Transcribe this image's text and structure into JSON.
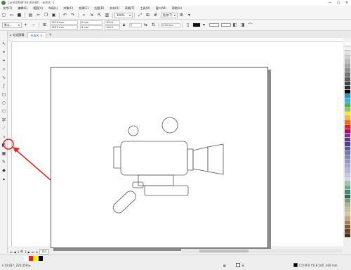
{
  "window": {
    "title": "CorelDRAW X8 (64-Bit) - 未命名 -1",
    "controls": [
      "—",
      "□",
      "✕"
    ]
  },
  "menu": [
    "文件(F)",
    "编辑(E)",
    "视图(V)",
    "布局(L)",
    "对象(C)",
    "效果(C)",
    "位图(B)",
    "文本(X)",
    "表格(T)",
    "工具(O)",
    "窗口(W)",
    "帮助(H)"
  ],
  "standard_toolbar": {
    "zoom_value": "100%",
    "snap_label": "贴齐(T)"
  },
  "property_bar": {
    "preset": "默认...",
    "x": "193.6 mm",
    "y": "148.3 mm",
    "w": "0 mm",
    "h": "0 mm",
    "scale_w": "100.0",
    "scale_h": "100.0",
    "rotation": "0",
    "outline": "2.54 mm"
  },
  "tabs": [
    {
      "label": "欢迎屏幕",
      "active": false
    },
    {
      "label": "未命名 -1",
      "active": true
    }
  ],
  "page_nav": {
    "current": "1",
    "of_label": "的",
    "total": "1",
    "page_tab": "页1"
  },
  "status": {
    "coords": "(-14.837, 220.459) ▸",
    "fill_label": "无",
    "outline_info": "C:0 M:0 Y:0 K:100  .200 mm"
  },
  "palette_colors": [
    "#ffffff",
    "#f2f2f2",
    "#e0e0e0",
    "#cfcfcf",
    "#bcbcbc",
    "#a6a6a6",
    "#8f8f8f",
    "#777777",
    "#5e5e5e",
    "#444444",
    "#2b2b2b",
    "#000000",
    "#1e8fe0",
    "#2bb5e8",
    "#3fb84b",
    "#8ccf3d",
    "#fff200",
    "#f7c500",
    "#ff6600",
    "#e3261b",
    "#b8005c",
    "#8a2a8a",
    "#6b2d9a",
    "#4b3f9e",
    "#5a5aa8",
    "#6f77b5",
    "#7b8ac0",
    "#8d97c6",
    "#9ea7cf",
    "#b1b8d8",
    "#c2c8e0",
    "#d3d8ea",
    "#9fc2b6",
    "#6ea88f",
    "#3d8f70",
    "#2e6e55",
    "#7a9a76",
    "#a8b48e",
    "#c8c49a",
    "#d9c9a0",
    "#c9a77a",
    "#a87f55",
    "#8a5a32",
    "#6e3f1f",
    "#4f2c14"
  ],
  "status_colors": {
    "swatch1": "#ffffff",
    "swatch2": "#e3261b",
    "swatch3": "#fff200",
    "swatch4": "#000000",
    "annotation": "#e3261b"
  },
  "canvas": {
    "shapes": [
      "circle-small",
      "circle-large",
      "camera-body",
      "lens-ring",
      "lens-cone",
      "viewfinder-left",
      "handle",
      "base-block",
      "grip"
    ]
  }
}
